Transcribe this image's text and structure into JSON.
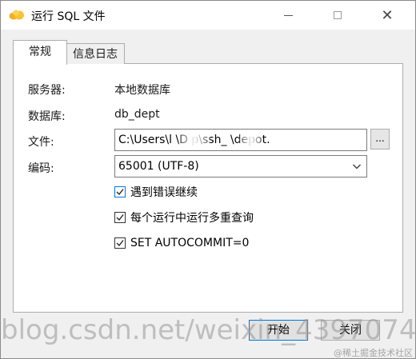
{
  "window": {
    "title": "运行 SQL 文件",
    "close_glyph": "✕"
  },
  "tabs": [
    {
      "label": "常规"
    },
    {
      "label": "信息日志"
    }
  ],
  "form": {
    "server_label": "服务器:",
    "server_value": "本地数据库",
    "database_label": "数据库:",
    "database_value": "db_dept",
    "file_label": "文件:",
    "file_value": "C:\\Users\\l        \\D    p\\ssh_        \\depot.",
    "browse_label": "...",
    "encoding_label": "编码:",
    "encoding_value": "65001 (UTF-8)"
  },
  "options": [
    {
      "label": "遇到错误继续",
      "checked": true
    },
    {
      "label": "每个运行中运行多重查询",
      "checked": true
    },
    {
      "label": "SET AUTOCOMMIT=0",
      "checked": true
    }
  ],
  "buttons": {
    "start": "开始",
    "close": "关闭"
  },
  "watermark": {
    "text": "blog.csdn.net/weixin_43970743",
    "corner": "@稀土掘金技术社区"
  },
  "colors": {
    "accent": "#0078d7",
    "titlebar": "#ffffff",
    "dialog_bg": "#f0f0f0"
  }
}
